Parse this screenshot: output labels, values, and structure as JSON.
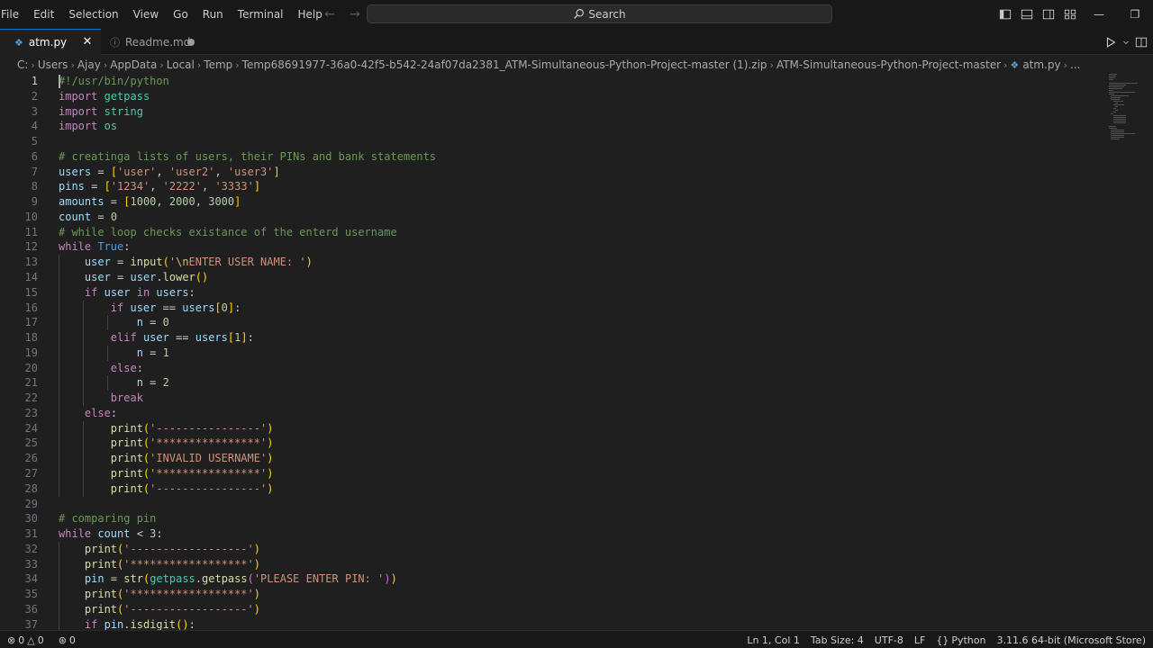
{
  "menu": [
    "File",
    "Edit",
    "Selection",
    "View",
    "Go",
    "Run",
    "Terminal",
    "Help"
  ],
  "search": {
    "label": "Search"
  },
  "tabs": [
    {
      "label": "atm.py",
      "active": true
    },
    {
      "label": "Readme.md",
      "active": false,
      "modified": true
    }
  ],
  "breadcrumb": [
    "C:",
    "Users",
    "Ajay",
    "AppData",
    "Local",
    "Temp",
    "Temp68691977-36a0-42f5-b542-24af07da2381_ATM-Simultaneous-Python-Project-master (1).zip",
    "ATM-Simultaneous-Python-Project-master",
    "atm.py",
    "..."
  ],
  "editor": {
    "lines": [
      {
        "n": "1",
        "text": "#!/usr/bin/python"
      },
      {
        "n": "2",
        "text": "import getpass"
      },
      {
        "n": "3",
        "text": "import string"
      },
      {
        "n": "4",
        "text": "import os"
      },
      {
        "n": "5",
        "text": ""
      },
      {
        "n": "6",
        "text": "# creatinga lists of users, their PINs and bank statements"
      },
      {
        "n": "7",
        "text": "users = ['user', 'user2', 'user3']"
      },
      {
        "n": "8",
        "text": "pins = ['1234', '2222', '3333']"
      },
      {
        "n": "9",
        "text": "amounts = [1000, 2000, 3000]"
      },
      {
        "n": "10",
        "text": "count = 0"
      },
      {
        "n": "11",
        "text": "# while loop checks existance of the enterd username"
      },
      {
        "n": "12",
        "text": "while True:"
      },
      {
        "n": "13",
        "text": "    user = input('\\nENTER USER NAME: ')"
      },
      {
        "n": "14",
        "text": "    user = user.lower()"
      },
      {
        "n": "15",
        "text": "    if user in users:"
      },
      {
        "n": "16",
        "text": "        if user == users[0]:"
      },
      {
        "n": "17",
        "text": "            n = 0"
      },
      {
        "n": "18",
        "text": "        elif user == users[1]:"
      },
      {
        "n": "19",
        "text": "            n = 1"
      },
      {
        "n": "20",
        "text": "        else:"
      },
      {
        "n": "21",
        "text": "            n = 2"
      },
      {
        "n": "22",
        "text": "        break"
      },
      {
        "n": "23",
        "text": "    else:"
      },
      {
        "n": "24",
        "text": "        print('----------------')"
      },
      {
        "n": "25",
        "text": "        print('****************')"
      },
      {
        "n": "26",
        "text": "        print('INVALID USERNAME')"
      },
      {
        "n": "27",
        "text": "        print('****************')"
      },
      {
        "n": "28",
        "text": "        print('----------------')"
      },
      {
        "n": "29",
        "text": ""
      },
      {
        "n": "30",
        "text": "# comparing pin"
      },
      {
        "n": "31",
        "text": "while count < 3:"
      },
      {
        "n": "32",
        "text": "    print('------------------')"
      },
      {
        "n": "33",
        "text": "    print('******************')"
      },
      {
        "n": "34",
        "text": "    pin = str(getpass.getpass('PLEASE ENTER PIN: '))"
      },
      {
        "n": "35",
        "text": "    print('******************')"
      },
      {
        "n": "36",
        "text": "    print('------------------')"
      },
      {
        "n": "37",
        "text": "    if pin.isdigit():"
      }
    ]
  },
  "status": {
    "errors": "0",
    "warnings": "0",
    "ports": "0",
    "position": "Ln 1, Col 1",
    "tab_size": "Tab Size: 4",
    "encoding": "UTF-8",
    "eol": "LF",
    "language": "Python",
    "interpreter": "3.11.6 64-bit (Microsoft Store)"
  },
  "colors": {
    "accent": "#0078d4",
    "background": "#1f1f1f",
    "chrome": "#181818"
  }
}
